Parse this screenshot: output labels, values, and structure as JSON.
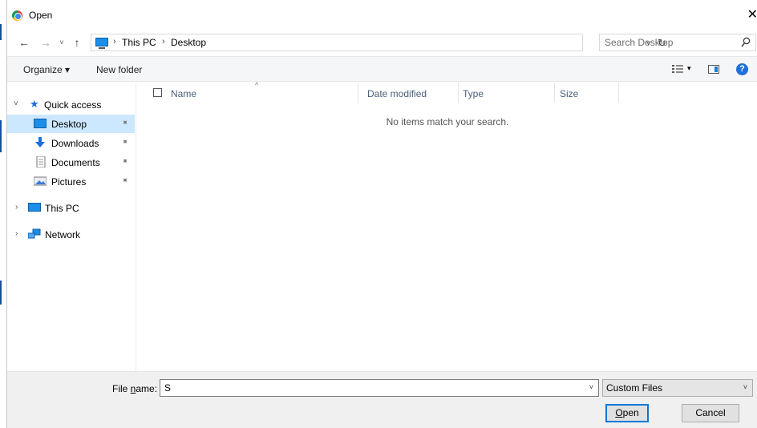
{
  "window": {
    "title": "Open",
    "close_glyph": "✕"
  },
  "address": {
    "back_glyph": "←",
    "forward_glyph": "→",
    "recent_glyph": "˅",
    "up_glyph": "↑",
    "crumbs": [
      "This PC",
      "Desktop"
    ],
    "crumb_sep": "›",
    "dropdown_glyph": "˅",
    "refresh_glyph": "↻"
  },
  "search": {
    "placeholder": "Search Desktop"
  },
  "toolbar": {
    "organize_label": "Organize ▾",
    "new_folder_label": "New folder",
    "view_drop_glyph": "▾",
    "help_glyph": "?"
  },
  "nav": {
    "quick_access": "Quick access",
    "desktop": "Desktop",
    "downloads": "Downloads",
    "documents": "Documents",
    "pictures": "Pictures",
    "this_pc": "This PC",
    "network": "Network",
    "pin_glyph": "📌",
    "expanded_glyph": "˅",
    "collapsed_glyph": "›"
  },
  "columns": {
    "name": "Name",
    "date_modified": "Date modified",
    "type": "Type",
    "size": "Size",
    "sort_glyph": "^"
  },
  "list": {
    "empty_message": "No items match your search."
  },
  "bottom": {
    "file_name_label_prefix": "File ",
    "file_name_label_underlined": "n",
    "file_name_label_suffix": "ame:",
    "file_name_value": "S",
    "file_type_value": "Custom Files",
    "dropdown_glyph": "˅",
    "open_label_underlined": "O",
    "open_label_rest": "pen",
    "cancel_label": "Cancel"
  }
}
